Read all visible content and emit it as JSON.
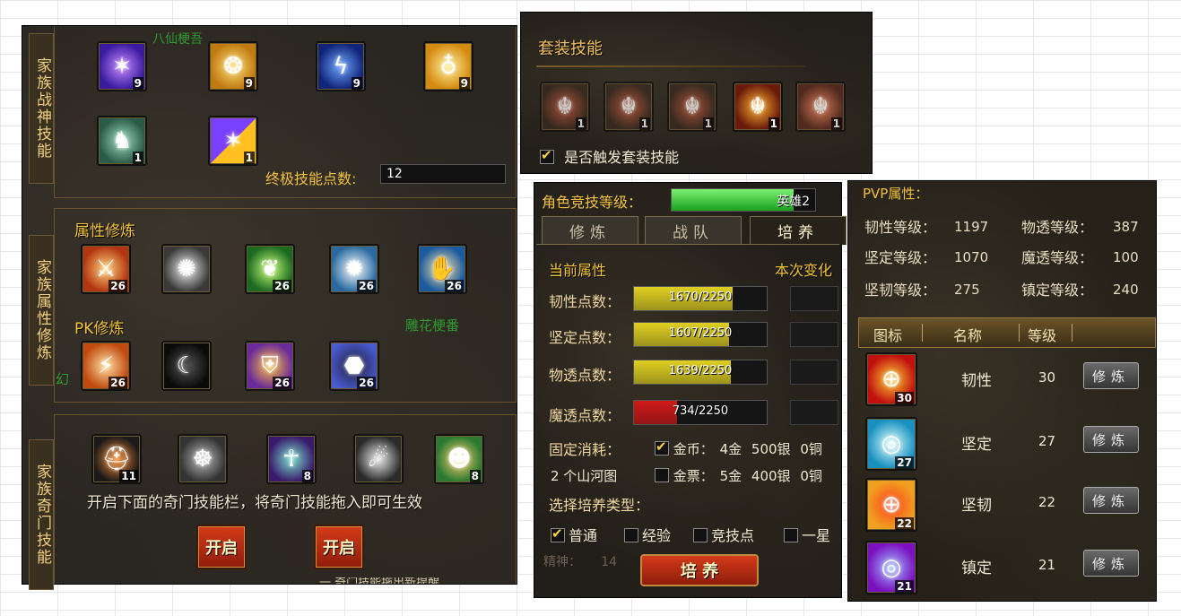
{
  "family_war": {
    "tab_label": "家族战神技能",
    "overlay_name": "八仙梗吾",
    "skills_row1": [
      {
        "icon": "purple-star-skill-icon",
        "level": "9"
      },
      {
        "icon": "gold-coins-skill-icon",
        "level": "9"
      },
      {
        "icon": "lightning-skill-icon",
        "level": "9"
      },
      {
        "icon": "gourd-skill-icon",
        "level": "9"
      }
    ],
    "skills_row2": [
      {
        "icon": "armored-warrior-skill-icon",
        "level": "1"
      },
      {
        "icon": "combo-skill-icon",
        "level": "1"
      }
    ],
    "ultimate_label": "终极技能点数:",
    "ultimate_value": "12"
  },
  "family_attr": {
    "tab_label": "家族属性修炼",
    "attr_title": "属性修炼",
    "attr_skills": [
      {
        "icon": "flame-sword-icon",
        "level": "26"
      },
      {
        "icon": "white-feather-icon",
        "level": "26"
      },
      {
        "icon": "green-leaf-icon",
        "level": "26"
      },
      {
        "icon": "light-burst-icon",
        "level": "26"
      },
      {
        "icon": "healing-hand-icon",
        "level": "26"
      }
    ],
    "pk_title": "PK修炼",
    "pk_overlay": "雕花梗番",
    "pk_partial": "幻",
    "pk_skills": [
      {
        "icon": "blade-strike-icon",
        "level": "26"
      },
      {
        "icon": "crescent-moon-icon",
        "level": "26"
      },
      {
        "icon": "golden-shield-icon",
        "level": "26"
      },
      {
        "icon": "dark-orb-icon",
        "level": "26"
      }
    ]
  },
  "family_qimen": {
    "tab_label": "家族奇门技能",
    "skills": [
      {
        "icon": "dark-helmet-icon",
        "level": "11"
      },
      {
        "icon": "stone-beast-icon",
        "level": ""
      },
      {
        "icon": "spirit-figure-icon",
        "level": "8"
      },
      {
        "icon": "claw-icon",
        "level": ""
      },
      {
        "icon": "meditating-monk-icon",
        "level": "8"
      }
    ],
    "hint": "开启下面的奇门技能栏，将奇门技能拖入即可生效",
    "open_buttons": [
      "开启",
      "开启"
    ],
    "bottom_partial": "一 奇门技能拖出新提醒"
  },
  "set_skills": {
    "title": "套装技能",
    "skills": [
      {
        "icon": "demon-crest-icon",
        "level": "1"
      },
      {
        "icon": "demon-crest-icon",
        "level": "1"
      },
      {
        "icon": "demon-crest-icon",
        "level": "1"
      },
      {
        "icon": "demon-crest-glow-icon",
        "level": "1"
      },
      {
        "icon": "demon-crest-icon",
        "level": "1"
      }
    ],
    "trigger_label": "是否触发套装技能",
    "trigger_checked": true
  },
  "cultivate": {
    "arena_label": "角色竞技等级：",
    "arena_value": "英雄2",
    "arena_fill": 0.85,
    "tabs": [
      "修炼",
      "战队",
      "培养"
    ],
    "active_tab": 2,
    "current_label": "当前属性",
    "change_label": "本次变化",
    "stats": [
      {
        "label": "韧性点数：",
        "value": "1670/2250",
        "fill": 0.742,
        "color": "#e0d020"
      },
      {
        "label": "坚定点数：",
        "value": "1607/2250",
        "fill": 0.714,
        "color": "#e0d020"
      },
      {
        "label": "物透点数：",
        "value": "1639/2250",
        "fill": 0.728,
        "color": "#e0d020"
      },
      {
        "label": "魔透点数：",
        "value": "734/2250",
        "fill": 0.326,
        "color": "#d01818"
      }
    ],
    "fixed_cost_label": "固定消耗：",
    "cost_gold_label": "金币：",
    "cost_gold": "4金",
    "cost_silver": "500银",
    "cost_copper": "0铜",
    "item_cost": "2 个山河图",
    "cost_ticket_label": "金票：",
    "ticket_gold": "5金",
    "ticket_silver": "400银",
    "ticket_copper": "0铜",
    "choose_label": "选择培养类型：",
    "types": [
      {
        "label": "普通",
        "checked": true
      },
      {
        "label": "经验",
        "checked": false
      },
      {
        "label": "竞技点",
        "checked": false
      },
      {
        "label": "一星",
        "checked": false
      }
    ],
    "cultivate_button": "培 养",
    "bg_text": "精神：     14"
  },
  "pvp": {
    "title": "PVP属性：",
    "attrs": [
      {
        "label": "韧性等级：",
        "value": "1197"
      },
      {
        "label": "物透等级：",
        "value": "387"
      },
      {
        "label": "坚定等级：",
        "value": "1070"
      },
      {
        "label": "魔透等级：",
        "value": "100"
      },
      {
        "label": "坚韧等级：",
        "value": "275"
      },
      {
        "label": "镇定等级：",
        "value": "240"
      }
    ],
    "headers": [
      "图标",
      "名称",
      "等级"
    ],
    "rows": [
      {
        "icon": "red-gold-seal-icon",
        "badge": "30",
        "name": "韧性",
        "level": "30",
        "btn": "修炼"
      },
      {
        "icon": "cyan-ring-icon",
        "badge": "27",
        "name": "坚定",
        "level": "27",
        "btn": "修炼"
      },
      {
        "icon": "gold-ring-icon",
        "badge": "22",
        "name": "坚韧",
        "level": "22",
        "btn": "修炼"
      },
      {
        "icon": "purple-ring-icon",
        "badge": "21",
        "name": "镇定",
        "level": "21",
        "btn": "修炼"
      }
    ]
  }
}
